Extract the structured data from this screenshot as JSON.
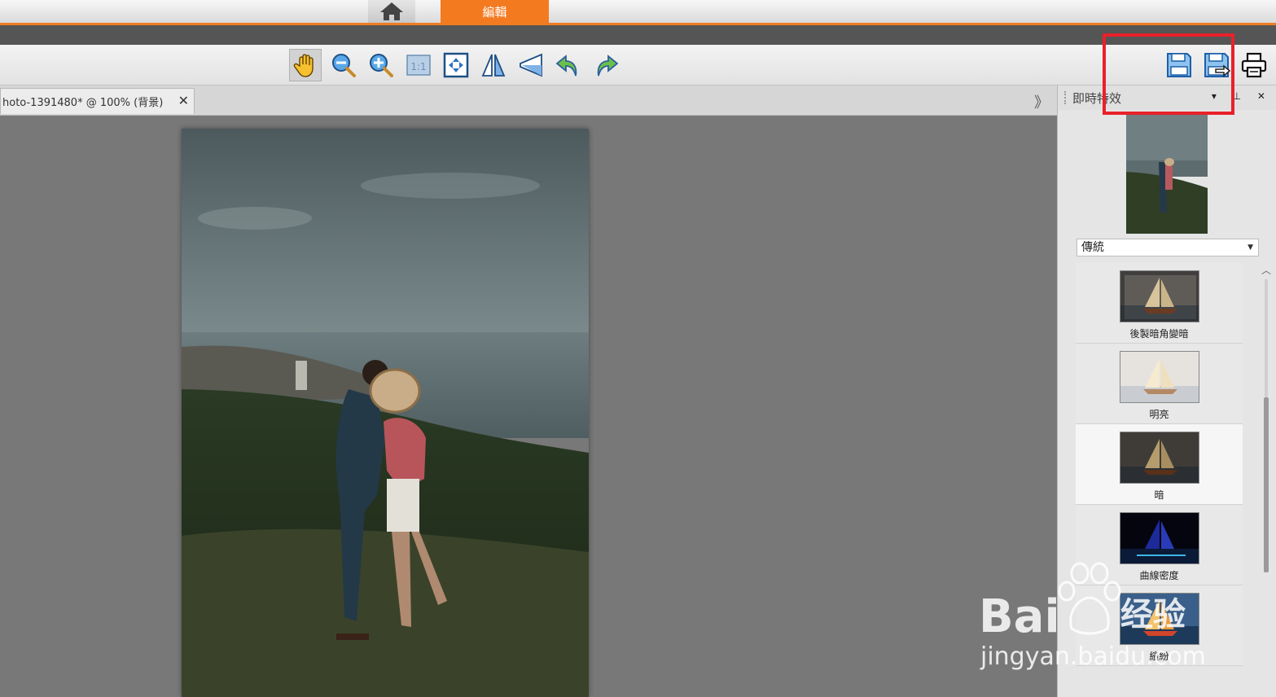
{
  "tabs": {
    "home_icon": "home-icon",
    "edit_label": "編輯"
  },
  "toolbar": {
    "tools": [
      "hand-icon",
      "zoom-out-icon",
      "zoom-in-icon",
      "actual-size-icon",
      "fit-window-icon",
      "flip-horizontal-icon",
      "flip-vertical-icon",
      "rotate-left-icon",
      "rotate-right-icon"
    ],
    "actual_size_label": "1:1",
    "save_icon": "save-icon",
    "save_as_icon": "save-as-icon",
    "print_icon": "print-icon"
  },
  "document": {
    "tab_title": "hoto-1391480* @ 100% (背景)",
    "close_glyph": "✕",
    "scroll_glyph": "》"
  },
  "panel": {
    "title": "即時特效",
    "controls": "▾ ⊥ ✕",
    "preset_selected": "傳統",
    "effects": [
      {
        "label": "後製暗角變暗",
        "selected": false
      },
      {
        "label": "明亮",
        "selected": false
      },
      {
        "label": "暗",
        "selected": true
      },
      {
        "label": "曲線密度",
        "selected": false
      },
      {
        "label": "繽紛",
        "selected": false
      }
    ]
  },
  "watermark": {
    "brand": "Bai",
    "suffix": "经验",
    "url": "jingyan.baidu.com"
  },
  "colors": {
    "accent": "#f47a20",
    "highlight": "#e8212a"
  }
}
